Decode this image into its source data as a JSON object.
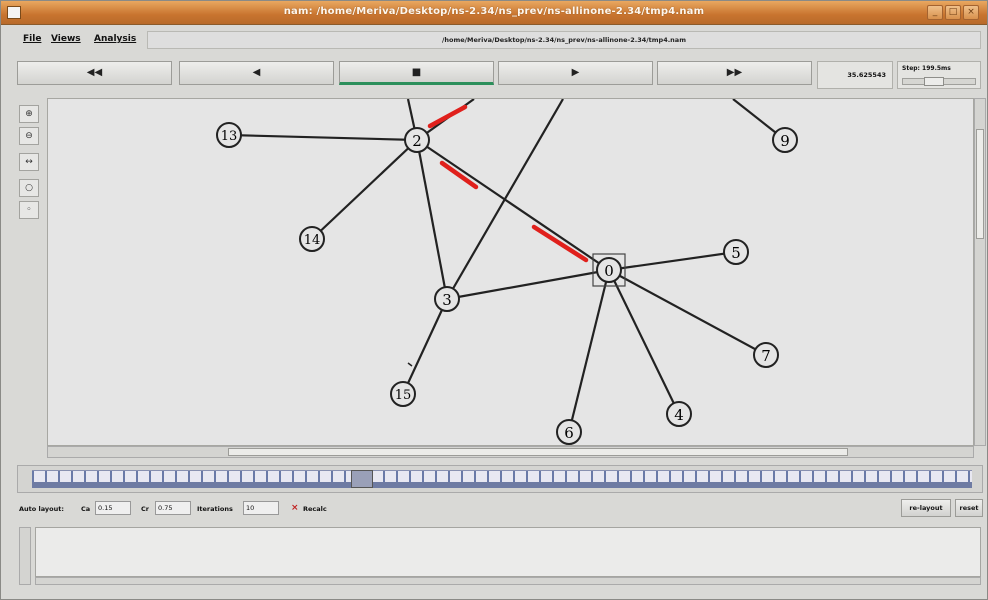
{
  "window": {
    "title": "nam: /home/Meriva/Desktop/ns-2.34/ns_prev/ns-allinone-2.34/tmp4.nam",
    "minimize": "_",
    "maximize": "□",
    "close": "×"
  },
  "menu": {
    "file": "File",
    "views": "Views",
    "analysis": "Analysis"
  },
  "filepath": "/home/Meriva/Desktop/ns-2.34/ns_prev/ns-allinone-2.34/tmp4.nam",
  "controls": {
    "rewind": "◀◀",
    "back": "◀",
    "stop": "■",
    "play": "▶",
    "fastforward": "▶▶"
  },
  "time": "35.625543",
  "step": {
    "label": "Step: 199.5ms"
  },
  "tools": [
    "⊕",
    "⊖",
    "↔",
    "○",
    "◦"
  ],
  "nodes": [
    {
      "id": "0"
    },
    {
      "id": "2"
    },
    {
      "id": "3"
    },
    {
      "id": "4"
    },
    {
      "id": "5"
    },
    {
      "id": "6"
    },
    {
      "id": "7"
    },
    {
      "id": "9"
    },
    {
      "id": "13"
    },
    {
      "id": "14"
    },
    {
      "id": "15"
    }
  ],
  "autolayout": {
    "label": "Auto layout:",
    "ca_label": "Ca",
    "ca_value": "0.15",
    "cr_label": "Cr",
    "cr_value": "0.75",
    "iter_label": "Iterations",
    "iter_value": "10",
    "recalc_label": "Recalc",
    "relayout": "re-layout",
    "reset": "reset"
  },
  "colors": {
    "accent": "#2c8f5b",
    "packet": "#e0201c",
    "titlebar": "#c8742f"
  }
}
